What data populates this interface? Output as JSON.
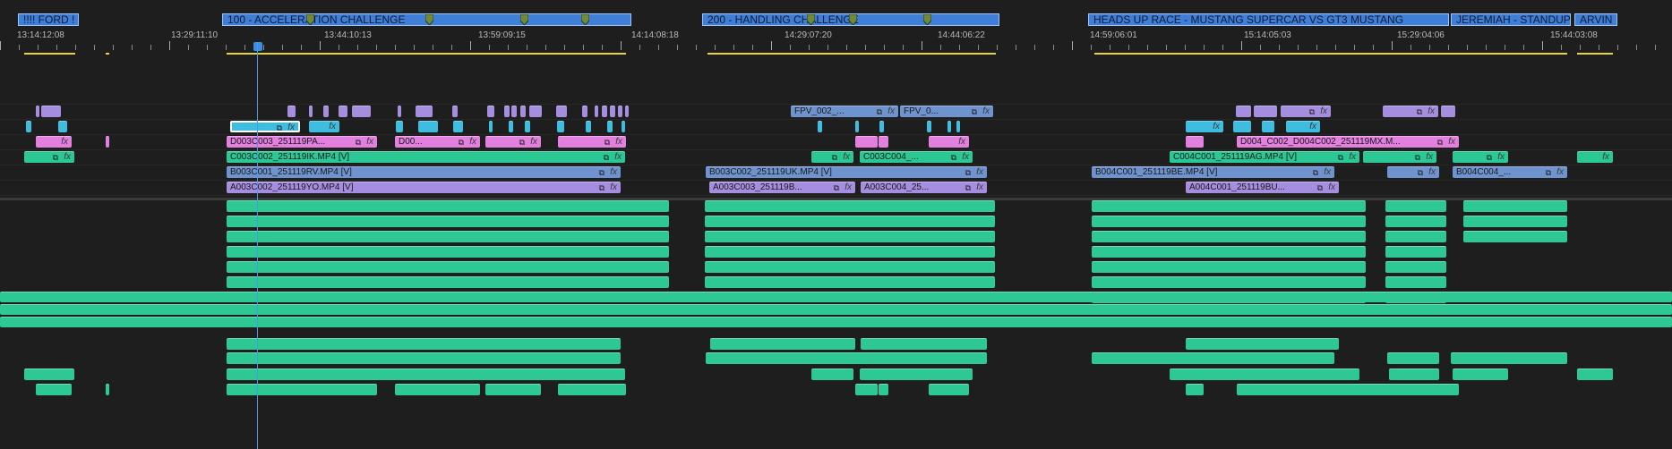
{
  "app": {
    "panel": "Timeline"
  },
  "markers": [
    {
      "label": "!!!! FORD !"
    },
    {
      "label": "100 - ACCELERATION CHALLENGE"
    },
    {
      "label": "200 - HANDLING CHALLENGE"
    },
    {
      "label": "HEADS UP RACE - MUSTANG SUPERCAR VS GT3 MUSTANG"
    },
    {
      "label": "JEREMIAH - STANDUP"
    },
    {
      "label": "ARVIN"
    }
  ],
  "timecodes": [
    "13:14:12:08",
    "13:29:11:10",
    "13:44:10:13",
    "13:59:09:15",
    "14:14:08:18",
    "14:29:07:20",
    "14:44:06:22",
    "14:59:06:01",
    "15:14:05:03",
    "15:29:04:06",
    "15:44:03:08"
  ],
  "clips": {
    "v1_a": "A003C002_251119YO.MP4 [V]",
    "v2_a": "B003C001_251119RV.MP4 [V]",
    "v3_a": "C003C002_251119IK.MP4 [V]",
    "v4_a": "D003C003_251119PA...",
    "v4_b": "D00...",
    "v1_b": "A003C003_251119B...",
    "v1_c": "A003C004_25...",
    "v2_b": "B003C002_251119UK.MP4 [V]",
    "v3_b": "C003C004_...",
    "v6_a": "FPV_002_...",
    "v6_b": "FPV_0...",
    "v2_c": "B004C001_251119BE.MP4 [V]",
    "v1_d": "A004C001_251119BU...",
    "v3_c": "C004C001_251119AG.MP4 [V]",
    "v4_c": "D004_C002_D004C002_251119MX.M...",
    "v2_d": "B004C004_..."
  },
  "fx_label": "fx",
  "link_glyph": "⧉",
  "colors": {
    "marker": "#3f7fd8",
    "playhead": "#4a98f0",
    "work_area": "#e8d43a",
    "video_purple": "#a58ee0",
    "video_blue": "#6e93cf",
    "video_green": "#2bc795",
    "video_pink": "#e37fde",
    "video_cyan": "#3fbde0",
    "audio_green": "#2dc894"
  }
}
